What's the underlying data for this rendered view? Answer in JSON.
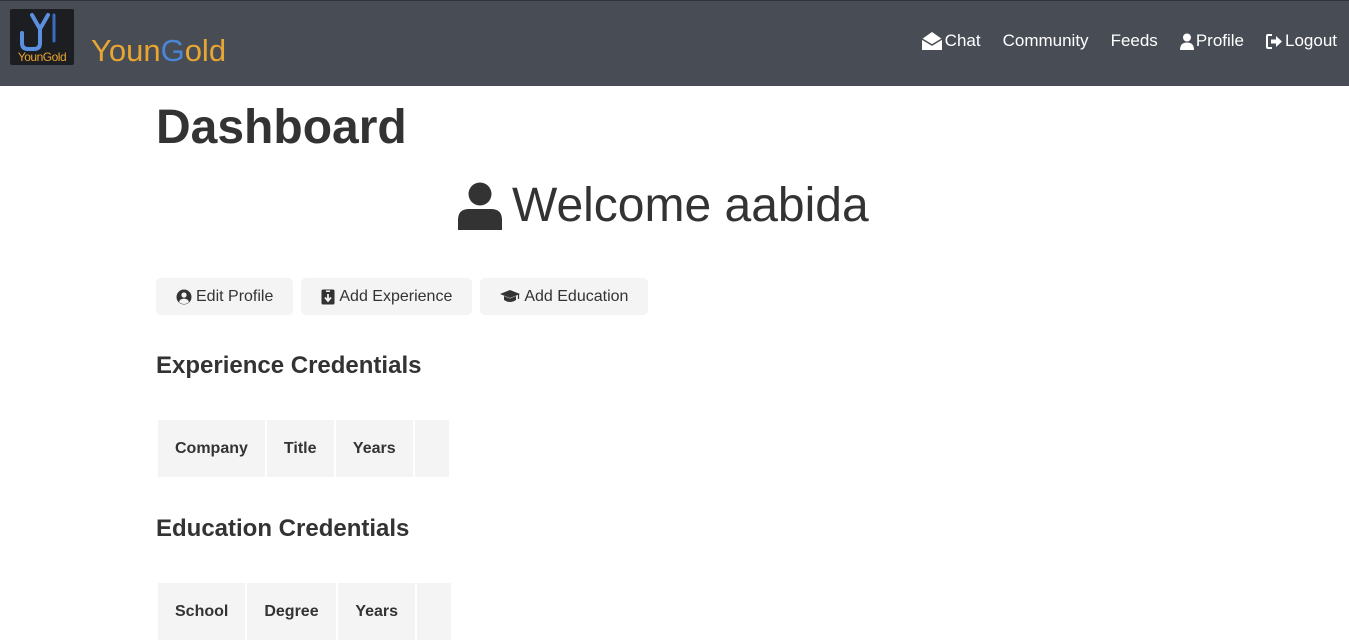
{
  "navbar": {
    "logo_caption": "YounGold",
    "brand": {
      "part1": "Youn",
      "part2": "G",
      "part3": "old"
    },
    "links": [
      {
        "label": "Chat",
        "icon": "envelope-open-icon"
      },
      {
        "label": "Community"
      },
      {
        "label": "Feeds"
      },
      {
        "label": "Profile",
        "icon": "user-icon"
      },
      {
        "label": "Logout",
        "icon": "sign-out-icon"
      }
    ]
  },
  "main": {
    "title": "Dashboard",
    "welcome": "Welcome aabida",
    "actions": [
      {
        "label": "Edit Profile",
        "icon": "user-circle-icon"
      },
      {
        "label": "Add Experience",
        "icon": "id-badge-icon"
      },
      {
        "label": "Add Education",
        "icon": "graduation-cap-icon"
      }
    ],
    "experience": {
      "title": "Experience Credentials",
      "headers": [
        "Company",
        "Title",
        "Years",
        ""
      ]
    },
    "education": {
      "title": "Education Credentials",
      "headers": [
        "School",
        "Degree",
        "Years",
        ""
      ]
    }
  },
  "colors": {
    "navbar_bg": "#474c55",
    "brand_gold": "#e8a531",
    "brand_blue": "#4b86d6",
    "button_bg": "#f4f4f4",
    "text": "#333333"
  }
}
